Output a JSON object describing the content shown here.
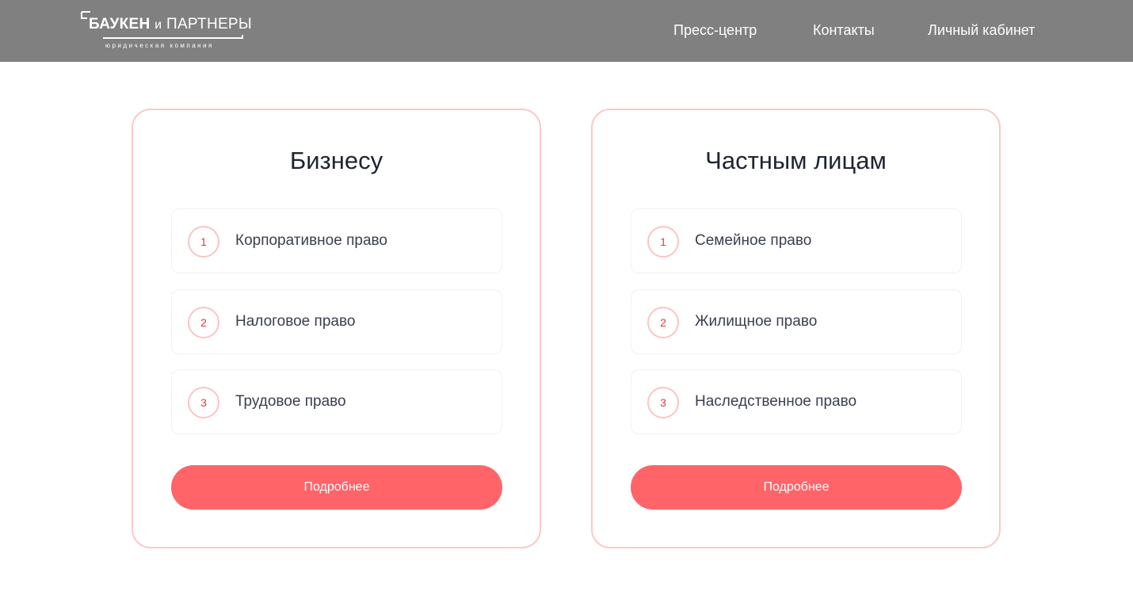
{
  "header": {
    "logo": {
      "name_bold": "БАУКЕН",
      "name_and": "и",
      "name_rest": "ПАРТНЕРЫ",
      "subtitle": "юридическая компания"
    },
    "nav": [
      {
        "label": "Пресс-центр"
      },
      {
        "label": "Контакты"
      },
      {
        "label": "Личный кабинет"
      }
    ]
  },
  "cards": [
    {
      "title": "Бизнесу",
      "items": [
        {
          "number": "1",
          "label": "Корпоративное право"
        },
        {
          "number": "2",
          "label": "Налоговое право"
        },
        {
          "number": "3",
          "label": "Трудовое право"
        }
      ],
      "button_label": "Подробнее"
    },
    {
      "title": "Частным лицам",
      "items": [
        {
          "number": "1",
          "label": "Семейное право"
        },
        {
          "number": "2",
          "label": "Жилищное право"
        },
        {
          "number": "3",
          "label": "Наследственное право"
        }
      ],
      "button_label": "Подробнее"
    }
  ],
  "colors": {
    "header_bg": "#808080",
    "accent": "#ff6468",
    "card_border": "#fcc9c9",
    "number_text": "#e83a3a"
  }
}
